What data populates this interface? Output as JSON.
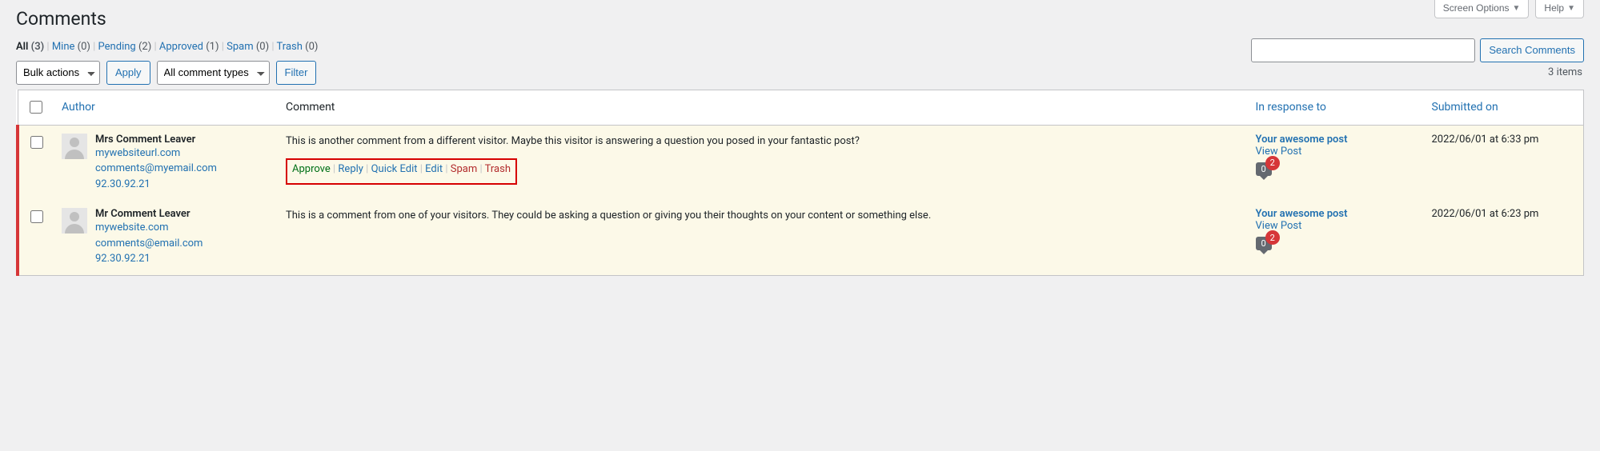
{
  "screen_options": {
    "label": "Screen Options",
    "help_label": "Help"
  },
  "page": {
    "title": "Comments"
  },
  "filters": {
    "tabs": [
      {
        "label": "All",
        "count": "(3)",
        "current": true
      },
      {
        "label": "Mine",
        "count": "(0)",
        "current": false
      },
      {
        "label": "Pending",
        "count": "(2)",
        "current": false
      },
      {
        "label": "Approved",
        "count": "(1)",
        "current": false
      },
      {
        "label": "Spam",
        "count": "(0)",
        "current": false
      },
      {
        "label": "Trash",
        "count": "(0)",
        "current": false
      }
    ]
  },
  "toolbar": {
    "bulk_label": "Bulk actions",
    "apply_label": "Apply",
    "type_label": "All comment types",
    "filter_label": "Filter",
    "items_count": "3 items"
  },
  "search": {
    "button_label": "Search Comments",
    "value": ""
  },
  "table": {
    "headers": {
      "author": "Author",
      "comment": "Comment",
      "response": "In response to",
      "submitted": "Submitted on"
    },
    "row_actions": {
      "approve": "Approve",
      "reply": "Reply",
      "quick_edit": "Quick Edit",
      "edit": "Edit",
      "spam": "Spam",
      "trash": "Trash"
    },
    "rows": [
      {
        "author_name": "Mrs Comment Leaver",
        "author_url": "mywebsiteurl.com",
        "author_email": "comments@myemail.com",
        "author_ip": "92.30.92.21",
        "comment": "This is another comment from a different visitor. Maybe this visitor is answering a question you posed in your fantastic post?",
        "show_actions_highlight": true,
        "response_title": "Your awesome post",
        "response_view": "View Post",
        "bubble_count": "0",
        "bubble_pending": "2",
        "submitted": "2022/06/01 at 6:33 pm"
      },
      {
        "author_name": "Mr Comment Leaver",
        "author_url": "mywebsite.com",
        "author_email": "comments@email.com",
        "author_ip": "92.30.92.21",
        "comment": "This is a comment from one of your visitors. They could be asking a question or giving you their thoughts on your content or something else.",
        "show_actions_highlight": false,
        "response_title": "Your awesome post",
        "response_view": "View Post",
        "bubble_count": "0",
        "bubble_pending": "2",
        "submitted": "2022/06/01 at 6:23 pm"
      }
    ]
  }
}
